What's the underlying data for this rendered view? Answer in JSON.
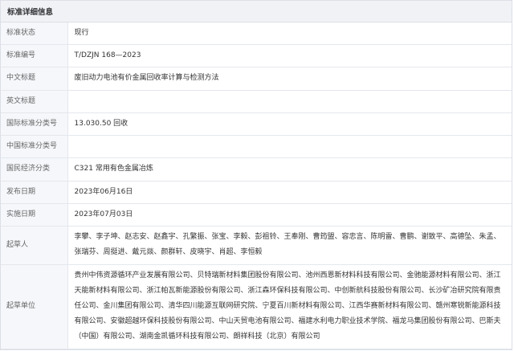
{
  "header": {
    "title": "标准详细信息"
  },
  "rows": [
    {
      "label": "标准状态",
      "value": "现行"
    },
    {
      "label": "标准编号",
      "value": "T/DZJN 168—2023"
    },
    {
      "label": "中文标题",
      "value": "废旧动力电池有价金属回收率计算与检测方法"
    },
    {
      "label": "英文标题",
      "value": ""
    },
    {
      "label": "国际标准分类号",
      "value": "13.030.50 回收"
    },
    {
      "label": "中国标准分类号",
      "value": ""
    },
    {
      "label": "国民经济分类",
      "value": "C321 常用有色金属冶炼"
    },
    {
      "label": "发布日期",
      "value": "2023年06月16日"
    },
    {
      "label": "实施日期",
      "value": "2023年07月03日"
    },
    {
      "label": "起草人",
      "value": "李攀、李子坤、赵志安、赵鑫宇、孔繁振、张宝、李毅、彭祖铃、王奉刚、曹筠盟、容忠言、陈明雷、曹鹏、谢致平、高德坠、朱孟、张瑞芬、周挺进、戴元燚、颜群轩、皮晓宇、肖超、李恒毅"
    },
    {
      "label": "起草单位",
      "value": "贵州中伟资源循环产业发展有限公司、贝特瑞新材料集团股份有限公司、池州西恩新材料科技有限公司、金驰能源材料有限公司、浙江天能新材料有限公司、浙江帕瓦新能源股份有限公司、浙江森环保科技有限公司、中创新航科技股份有限公司、长沙矿冶研究院有限责任公司、金川集团有限公司、清华四川能源互联网研究院、宁夏百川新材料有限公司、江西华赛新材料有限公司、赣州寒锐新能源科技有限公司、安徽超越环保科技股份有限公司、中山天贸电池有限公司、福建水利电力职业技术学院、福龙马集团股份有限公司、巴斯夫（中国）有限公司、湖南金凯循环科技有限公司、朗祥科技（北京）有限公司"
    }
  ]
}
